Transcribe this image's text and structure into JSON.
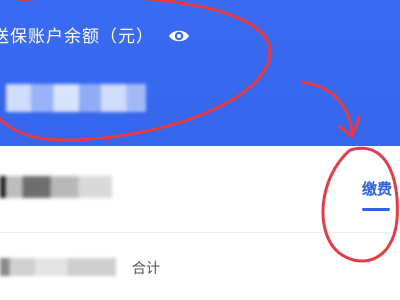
{
  "header": {
    "balance_label": "送保账户余额（元）",
    "balance_masked": true
  },
  "card": {
    "pay_tab_label": "缴费",
    "total_label": "合计"
  },
  "colors": {
    "header_blue": "#3566ec",
    "accent": "#2f62ea",
    "annotation_red": "#e63b45"
  },
  "icons": {
    "visibility": "eye-icon"
  }
}
